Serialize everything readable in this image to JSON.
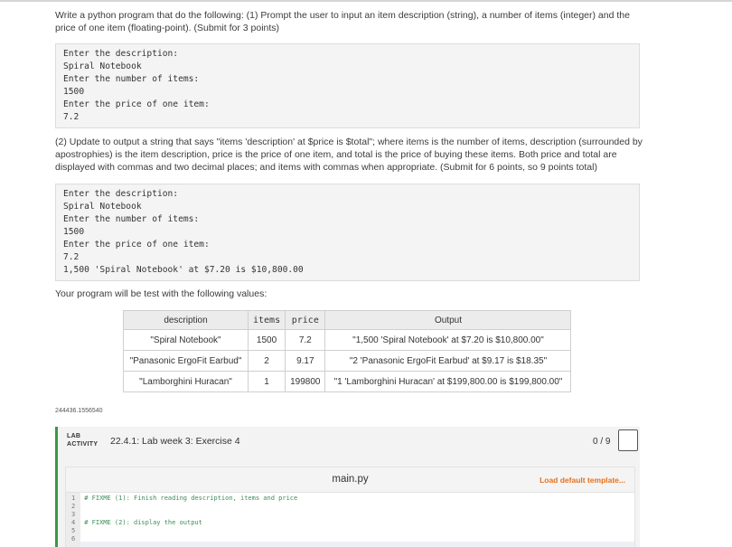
{
  "intro": "Write a python program that do the following: (1) Prompt the user to input an item description (string), a number of items (integer) and the price of one item (floating-point). (Submit for 3 points)",
  "sample1": [
    "Enter the description:",
    "Spiral Notebook",
    "Enter the number of items:",
    "1500",
    "Enter the price of one item:",
    "7.2"
  ],
  "part2": "(2) Update to output a string that says \"items 'description' at $price is $total\"; where items is the number of items, description (surrounded by apostrophies) is the item description, price is the price of one item, and total is the price of buying these items. Both price and total are displayed with commas and two decimal places; and items with commas when appropriate. (Submit for 6 points, so 9 points total)",
  "sample2": [
    "Enter the description:",
    "Spiral Notebook",
    "Enter the number of items:",
    "1500",
    "Enter the price of one item:",
    "7.2",
    "1,500 'Spiral Notebook' at $7.20 is $10,800.00"
  ],
  "test_intro": "Your program will be test with the following values:",
  "test_table": {
    "headers": [
      "description",
      "items",
      "price",
      "Output"
    ],
    "rows": [
      [
        "\"Spiral Notebook\"",
        "1500",
        "7.2",
        "\"1,500 'Spiral Notebook' at $7.20 is $10,800.00\""
      ],
      [
        "\"Panasonic ErgoFit Earbud\"",
        "2",
        "9.17",
        "\"2 'Panasonic ErgoFit Earbud' at $9.17 is $18.35\""
      ],
      [
        "\"Lamborghini Huracan\"",
        "1",
        "199800",
        "\"1 'Lamborghini Huracan' at $199,800.00 is $199,800.00\""
      ]
    ]
  },
  "tiny_id": "244436.1556540",
  "lab": {
    "tag_line1": "LAB",
    "tag_line2": "ACTIVITY",
    "title": "22.4.1: Lab week 3: Exercise 4",
    "score": "0 / 9",
    "filename": "main.py",
    "load_template": "Load default template...",
    "code_lines": [
      {
        "num": "1",
        "text": "# FIXME (1): Finish reading description, items and price"
      },
      {
        "num": "2",
        "text": ""
      },
      {
        "num": "3",
        "text": ""
      },
      {
        "num": "4",
        "text": "# FIXME (2): display the output"
      },
      {
        "num": "5",
        "text": ""
      },
      {
        "num": "6",
        "text": ""
      }
    ]
  }
}
